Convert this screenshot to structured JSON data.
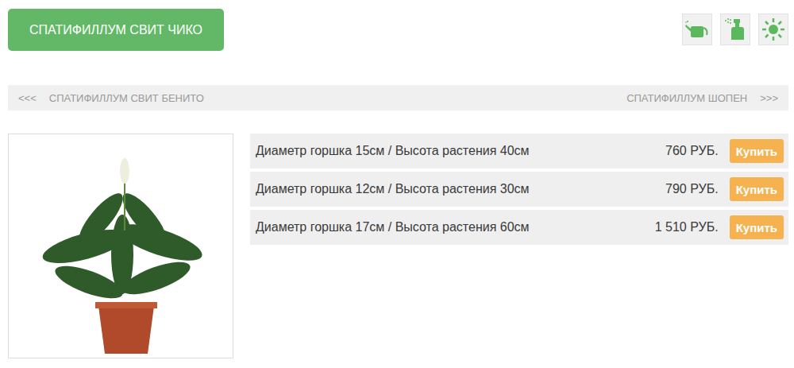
{
  "product": {
    "title": "СПАТИФИЛЛУМ СВИТ ЧИКО"
  },
  "nav": {
    "prev": {
      "arrow": "<<<",
      "label": "СПАТИФИЛЛУМ СВИТ БЕНИТО"
    },
    "next": {
      "label": "СПАТИФИЛЛУМ ШОПЕН",
      "arrow": ">>>"
    }
  },
  "variants": [
    {
      "label": "Диаметр горшка 15см / Высота растения 40см",
      "price": "760 РУБ.",
      "button": "Купить"
    },
    {
      "label": "Диаметр горшка 12см / Высота растения 30см",
      "price": "790 РУБ.",
      "button": "Купить"
    },
    {
      "label": "Диаметр горшка 17см / Высота растения 60см",
      "price": "1 510 РУБ.",
      "button": "Купить"
    }
  ]
}
